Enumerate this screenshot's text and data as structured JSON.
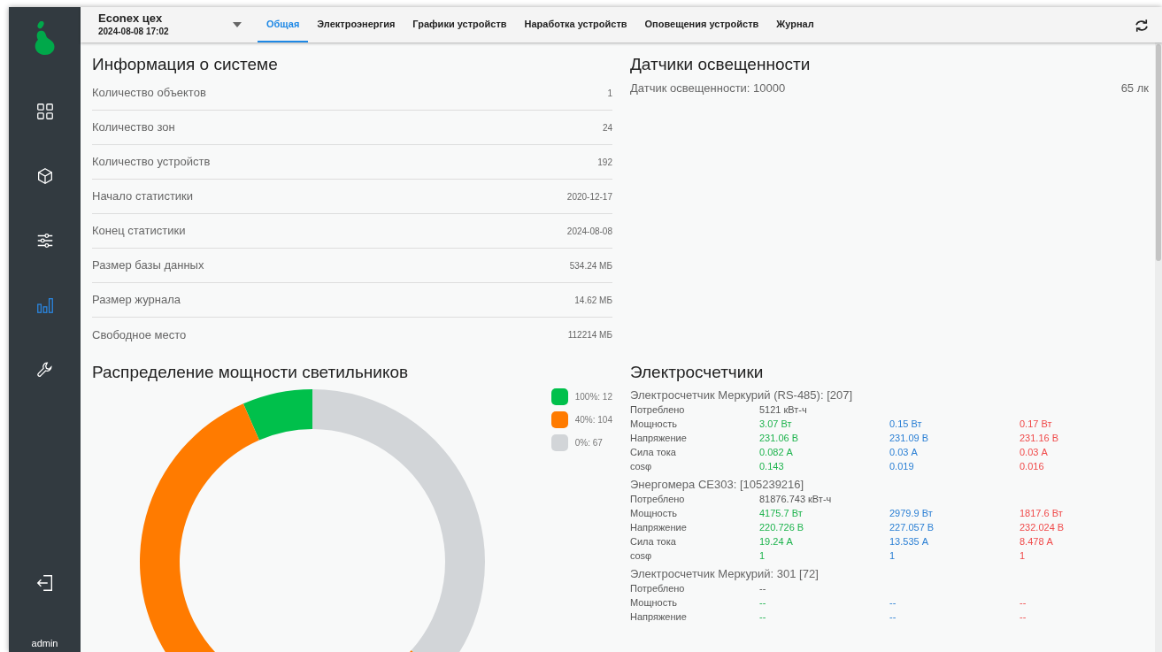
{
  "sidebar": {
    "items": [
      {
        "kind": "grid",
        "selected": false
      },
      {
        "kind": "cube",
        "selected": false
      },
      {
        "kind": "sliders",
        "selected": false
      },
      {
        "kind": "bars",
        "selected": true
      },
      {
        "kind": "wrench",
        "selected": false
      }
    ],
    "user": "admin"
  },
  "header": {
    "title": "Econex цех",
    "datetime": "2024-08-08 17:02"
  },
  "tabs": [
    {
      "label": "Общая",
      "selected": true
    },
    {
      "label": "Электроэнергия",
      "selected": false
    },
    {
      "label": "Графики устройств",
      "selected": false
    },
    {
      "label": "Наработка устройств",
      "selected": false
    },
    {
      "label": "Оповещения устройств",
      "selected": false
    },
    {
      "label": "Журнал",
      "selected": false
    }
  ],
  "system_info": {
    "title": "Информация о системе",
    "rows": [
      {
        "label": "Количество объектов",
        "value": "1"
      },
      {
        "label": "Количество зон",
        "value": "24"
      },
      {
        "label": "Количество устройств",
        "value": "192"
      },
      {
        "label": "Начало статистики",
        "value": "2020-12-17"
      },
      {
        "label": "Конец статистики",
        "value": "2024-08-08"
      },
      {
        "label": "Размер базы данных",
        "value": "534.24 МБ"
      },
      {
        "label": "Размер журнала",
        "value": "14.62 МБ"
      },
      {
        "label": "Свободное место",
        "value": "112214 МБ"
      }
    ]
  },
  "light_sensors": {
    "title": "Датчики освещенности",
    "items": [
      {
        "label": "Датчик освещенности: 10000",
        "value": "65 лк"
      }
    ]
  },
  "power_distribution": {
    "title": "Распределение мощности светильников",
    "legend": [
      {
        "color": "#00c04b"
      },
      {
        "color": "#ff7b00"
      },
      {
        "color": "#d2d5d8"
      }
    ],
    "chart_data": {
      "type": "donut",
      "categories": [
        "100%: 12",
        "40%: 104",
        "0%: 67"
      ],
      "values": [
        12,
        104,
        67
      ]
    }
  },
  "meters": {
    "title": "Электросчетчики",
    "devices": [
      {
        "name": "Электросчетчик Меркурий (RS-485): [207]",
        "rows": [
          {
            "label": "Потреблено",
            "values": [
              "5121 кВт-ч"
            ]
          },
          {
            "label": "Мощность",
            "values": [
              "3.07 Вт",
              "0.15 Вт",
              "0.17 Вт"
            ]
          },
          {
            "label": "Напряжение",
            "values": [
              "231.06 В",
              "231.09 В",
              "231.16 В"
            ]
          },
          {
            "label": "Сила тока",
            "values": [
              "0.082 А",
              "0.03 А",
              "0.03 А"
            ]
          },
          {
            "label": "cosφ",
            "values": [
              "0.143",
              "0.019",
              "0.016"
            ]
          }
        ]
      },
      {
        "name": "Энергомера CE303: [105239216]",
        "rows": [
          {
            "label": "Потреблено",
            "values": [
              "81876.743 кВт-ч"
            ]
          },
          {
            "label": "Мощность",
            "values": [
              "4175.7 Вт",
              "2979.9 Вт",
              "1817.6 Вт"
            ]
          },
          {
            "label": "Напряжение",
            "values": [
              "220.726 В",
              "227.057 В",
              "232.024 В"
            ]
          },
          {
            "label": "Сила тока",
            "values": [
              "19.24 А",
              "13.535 А",
              "8.478 А"
            ]
          },
          {
            "label": "cosφ",
            "values": [
              "1",
              "1",
              "1"
            ]
          }
        ]
      },
      {
        "name": "Электросчетчик Меркурий: 301 [72]",
        "rows": [
          {
            "label": "Потреблено",
            "values": [
              "--"
            ]
          },
          {
            "label": "Мощность",
            "values": [
              "--",
              "--",
              "--"
            ]
          },
          {
            "label": "Напряжение",
            "values": [
              "--",
              "--",
              "--"
            ]
          }
        ]
      }
    ]
  }
}
